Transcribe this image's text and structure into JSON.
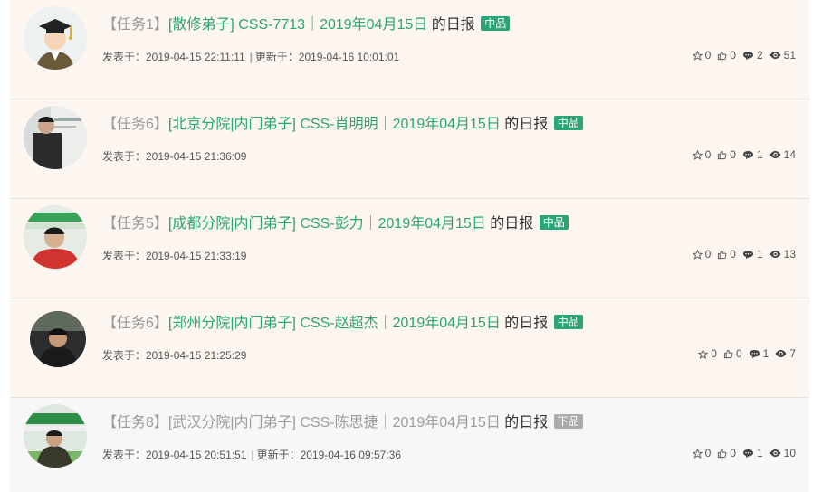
{
  "items": [
    {
      "task": "【任务1】",
      "title": "[散修弟子] CSS-7713｜2019年04月15日",
      "suffix": "的日报",
      "badge": "中品",
      "published": "发表于：2019-04-15 22:11:11",
      "updated": "更新于：2019-04-16 10:01:01",
      "stars": "0",
      "likes": "0",
      "comments": "2",
      "views": "51",
      "avatar": "graduate-cartoon"
    },
    {
      "task": "【任务6】",
      "title": "[北京分院|内门弟子] CSS-肖明明｜2019年04月15日",
      "suffix": "的日报",
      "badge": "中品",
      "published": "发表于：2019-04-15 21:36:09",
      "updated": "",
      "stars": "0",
      "likes": "0",
      "comments": "1",
      "views": "14",
      "avatar": "photo"
    },
    {
      "task": "【任务5】",
      "title": "[成都分院|内门弟子] CSS-彭力｜2019年04月15日",
      "suffix": "的日报",
      "badge": "中品",
      "published": "发表于：2019-04-15 21:33:19",
      "updated": "",
      "stars": "0",
      "likes": "0",
      "comments": "1",
      "views": "13",
      "avatar": "photo"
    },
    {
      "task": "【任务6】",
      "title": "[郑州分院|内门弟子] CSS-赵超杰｜2019年04月15日",
      "suffix": "的日报",
      "badge": "中品",
      "published": "发表于：2019-04-15 21:25:29",
      "updated": "",
      "stars": "0",
      "likes": "0",
      "comments": "1",
      "views": "7",
      "avatar": "photo"
    },
    {
      "task": "【任务8】",
      "title": "[武汉分院|内门弟子] CSS-陈思捷｜2019年04月15日",
      "suffix": "的日报",
      "badge": "下品",
      "published": "发表于：2019-04-15 20:51:51",
      "updated": "更新于：2019-04-16 09:57:36",
      "stars": "0",
      "likes": "0",
      "comments": "1",
      "views": "10",
      "avatar": "photo"
    }
  ],
  "colors": {
    "accent": "#2aa676",
    "badge_mid": "#2aa676",
    "badge_low": "#aaaaaa",
    "row_bg": "#fdf5ef",
    "row_bg_muted": "#f7f7f7"
  },
  "icons": {
    "stars": "star-outline-icon",
    "likes": "thumbs-up-icon",
    "comments": "comment-icon",
    "views": "eye-icon"
  }
}
